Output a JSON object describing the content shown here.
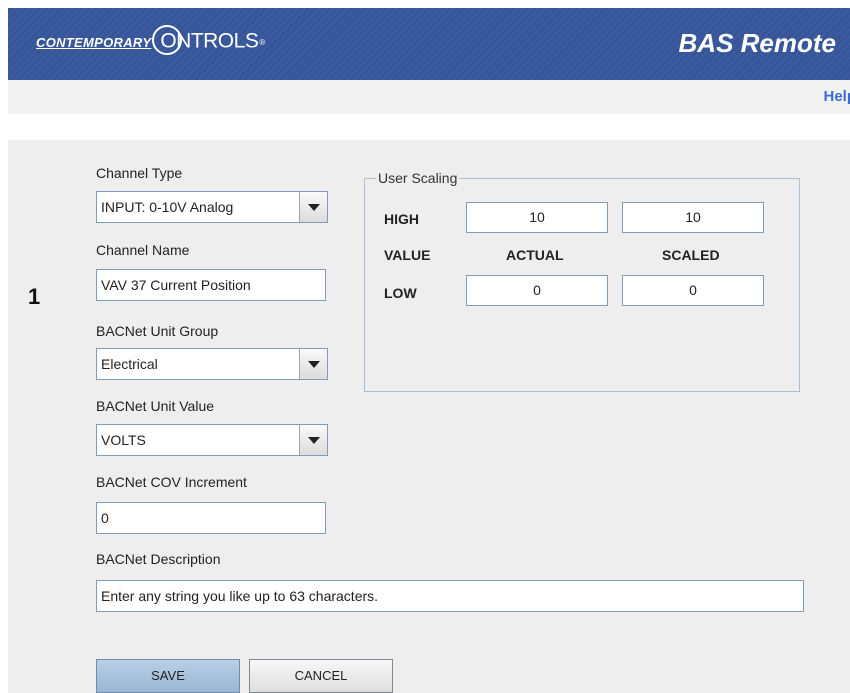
{
  "header": {
    "logo_part1": "CONTEMPORARY",
    "logo_part2": "ONTROLS",
    "logo_tm": "®",
    "product_title": "BAS Remote",
    "help_label": "Help"
  },
  "channel": {
    "number": "1",
    "channel_type": {
      "label": "Channel Type",
      "value": "INPUT: 0-10V Analog"
    },
    "channel_name": {
      "label": "Channel Name",
      "value": "VAV 37 Current Position"
    },
    "unit_group": {
      "label": "BACNet Unit Group",
      "value": "Electrical"
    },
    "unit_value": {
      "label": "BACNet Unit Value",
      "value": "VOLTS"
    },
    "cov_increment": {
      "label": "BACNet COV Increment",
      "value": "0"
    },
    "description": {
      "label": "BACNet Description",
      "value": "Enter any string you like up to 63 characters."
    }
  },
  "user_scaling": {
    "legend": "User Scaling",
    "high_label": "HIGH",
    "value_label": "VALUE",
    "low_label": "LOW",
    "actual_header": "ACTUAL",
    "scaled_header": "SCALED",
    "high_actual": "10",
    "high_scaled": "10",
    "low_actual": "0",
    "low_scaled": "0"
  },
  "buttons": {
    "save": "SAVE",
    "cancel": "CANCEL"
  },
  "colors": {
    "banner": "#37569a",
    "help_link": "#3b6cd4",
    "panel": "#eeeeee"
  }
}
